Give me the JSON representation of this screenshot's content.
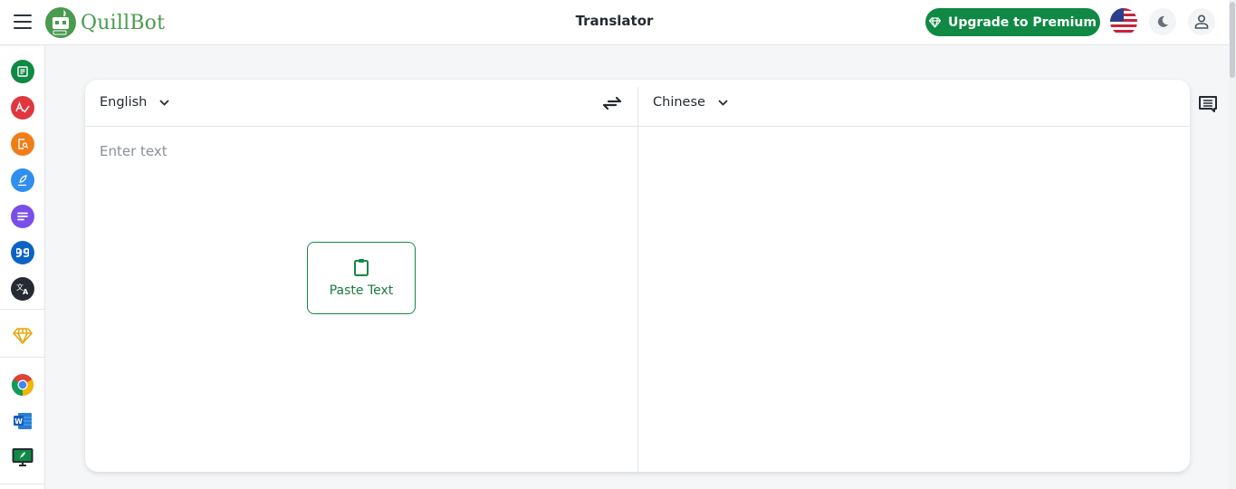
{
  "header": {
    "brand": "QuillBot",
    "title": "Translator",
    "upgrade_label": "Upgrade to Premium",
    "locale_flag": "us-flag-icon",
    "theme_toggle": "moon-icon",
    "account": "user-icon"
  },
  "sidebar": {
    "items": [
      {
        "name": "paraphraser",
        "icon": "paraphraser-icon",
        "color": "#108944"
      },
      {
        "name": "grammar-checker",
        "icon": "grammar-check-icon",
        "color": "#e0363f"
      },
      {
        "name": "plagiarism-checker",
        "icon": "plagiarism-icon",
        "color": "#f07d18"
      },
      {
        "name": "co-writer",
        "icon": "quill-icon",
        "color": "#2f8ef0"
      },
      {
        "name": "summarizer",
        "icon": "summarizer-icon",
        "color": "#7a4ee8"
      },
      {
        "name": "citation-generator",
        "icon": "quote-icon",
        "color": "#0d63c4"
      },
      {
        "name": "translator",
        "icon": "translate-icon",
        "color": "#252a33"
      }
    ],
    "premium": {
      "icon": "diamond-icon",
      "color": "#e3a812"
    },
    "extensions": [
      {
        "name": "chrome-extension",
        "icon": "chrome-icon"
      },
      {
        "name": "word-addin",
        "icon": "word-icon"
      },
      {
        "name": "desktop-app",
        "icon": "desktop-icon"
      }
    ]
  },
  "translator": {
    "source_language": "English",
    "target_language": "Chinese",
    "input_placeholder": "Enter text",
    "input_value": "",
    "paste_label": "Paste Text",
    "output_value": ""
  },
  "colors": {
    "brand_green": "#108944",
    "background": "#f5f6f7"
  }
}
